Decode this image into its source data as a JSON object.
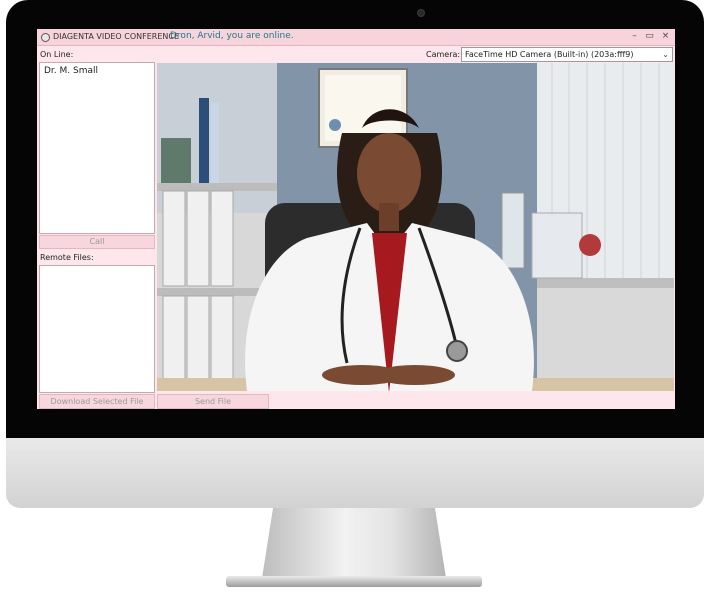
{
  "app": {
    "title": "DIAGENTA VIDEO CONFERENCE",
    "status": "Dron, Arvid, you are online."
  },
  "window_controls": {
    "minimize": "–",
    "maximize": "▭",
    "close": "×"
  },
  "online_panel": {
    "label": "On Line:",
    "users": [
      "Dr. M. Small"
    ],
    "call_button": "Call"
  },
  "remote_panel": {
    "label": "Remote Files:",
    "download_button": "Download Selected File"
  },
  "camera": {
    "label": "Camera:",
    "selected": "FaceTime HD Camera (Built-in) (203a:fff9)"
  },
  "footer": {
    "send_button": "Send File"
  },
  "colors": {
    "window_bg": "#fde7ec",
    "title_bar": "#f7d3dc",
    "status_text": "#1f7a86"
  }
}
